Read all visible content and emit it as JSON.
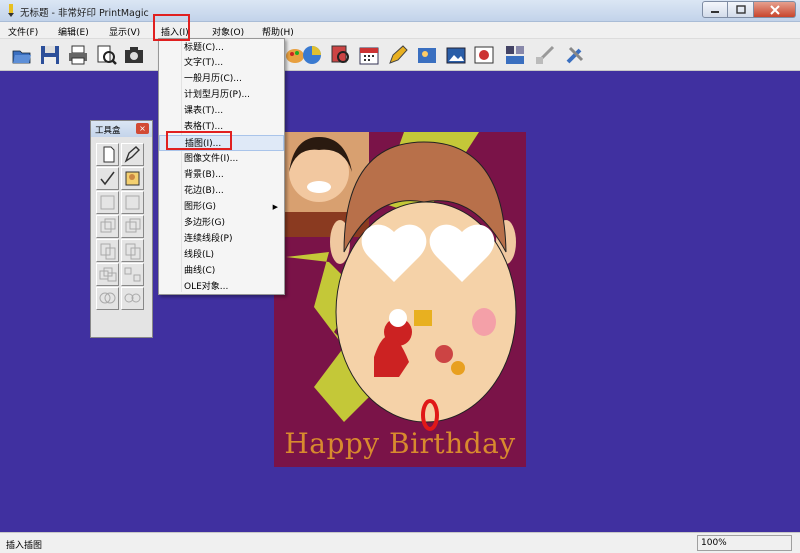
{
  "window": {
    "title": "无标题 - 非常好印 PrintMagic"
  },
  "menubar": {
    "items": [
      {
        "label": "文件(F)"
      },
      {
        "label": "编辑(E)"
      },
      {
        "label": "显示(V)"
      },
      {
        "label": "插入(I)"
      },
      {
        "label": "对象(O)"
      },
      {
        "label": "帮助(H)"
      }
    ]
  },
  "insert_menu": {
    "items": [
      {
        "label": "标题(C)..."
      },
      {
        "label": "文字(T)..."
      },
      {
        "label": "一般月历(C)..."
      },
      {
        "label": "计划型月历(P)..."
      },
      {
        "label": "课表(T)..."
      },
      {
        "label": "表格(T)..."
      },
      {
        "label": "插图(I)..."
      },
      {
        "label": "图像文件(I)..."
      },
      {
        "label": "背景(B)..."
      },
      {
        "label": "花边(B)..."
      },
      {
        "label": "图形(G)"
      },
      {
        "label": "多边形(G)"
      },
      {
        "label": "连续线段(P)"
      },
      {
        "label": "线段(L)"
      },
      {
        "label": "曲线(C)"
      },
      {
        "label": "OLE对象..."
      }
    ]
  },
  "toolbox": {
    "title": "工具盒"
  },
  "card": {
    "text": "Happy Birthday"
  },
  "statusbar": {
    "message": "插入插图",
    "zoom": "100%"
  },
  "colors": {
    "workspace": "#4030a0",
    "highlight": "#e02020",
    "card_bg": "#7a1348",
    "card_text": "#d88a2e"
  }
}
